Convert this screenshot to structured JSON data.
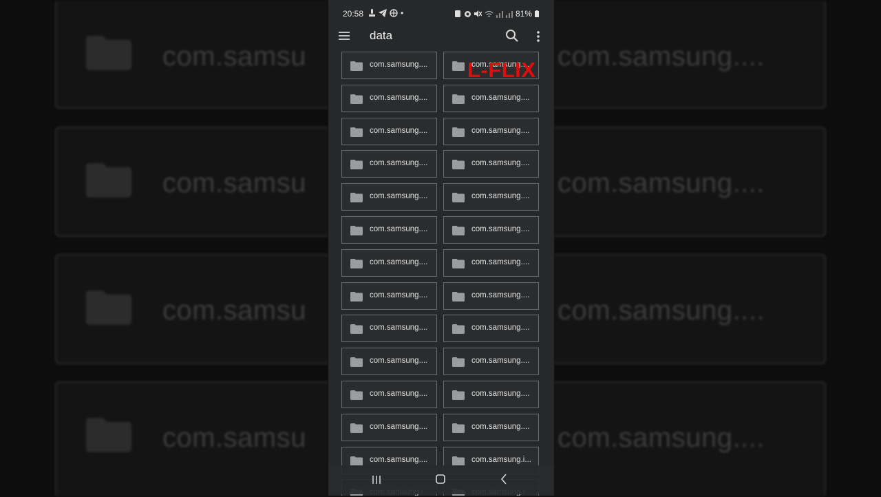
{
  "background": {
    "cards": [
      {
        "left_label": "com.samsu",
        "right_label": "com.samsung...."
      },
      {
        "left_label": "com.samsu",
        "right_label": "com.samsung...."
      },
      {
        "left_label": "com.samsu",
        "right_label": "com.samsung...."
      },
      {
        "left_label": "com.samsu",
        "right_label": "com.samsung...."
      }
    ]
  },
  "status_bar": {
    "time": "20:58",
    "dot": "•",
    "battery": "81%"
  },
  "app_bar": {
    "title": "data",
    "menu_icon": "hamburger-menu-icon",
    "search_icon": "search-icon",
    "more_icon": "more-vert-icon"
  },
  "watermark": "L-FLIX",
  "folders": [
    "com.samsung....",
    "com.samsung....",
    "com.samsung....",
    "com.samsung....",
    "com.samsung....",
    "com.samsung....",
    "com.samsung....",
    "com.samsung....",
    "com.samsung....",
    "com.samsung....",
    "com.samsung....",
    "com.samsung....",
    "com.samsung....",
    "com.samsung....",
    "com.samsung....",
    "com.samsung....",
    "com.samsung....",
    "com.samsung....",
    "com.samsung....",
    "com.samsung....",
    "com.samsung....",
    "com.samsung....",
    "com.samsung....",
    "com.samsung....",
    "com.samsung....",
    "com.samsung.i...",
    "com.samsung.i",
    "com.samsung.i"
  ],
  "colors": {
    "accent_watermark": "#e10d0d",
    "tile_border": "#6a6c6e",
    "phone_bg": "#26282a"
  }
}
